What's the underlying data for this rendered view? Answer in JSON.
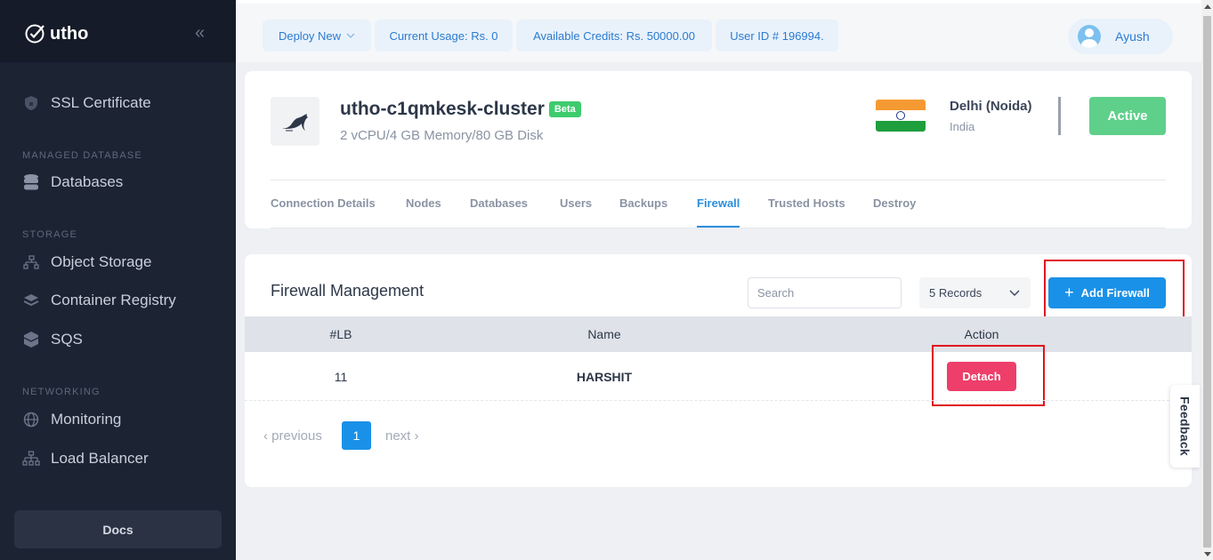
{
  "brand": {
    "name": "utho"
  },
  "sidebar": {
    "items": [
      {
        "label": "SSL Certificate",
        "icon": "shield-icon"
      },
      {
        "label": "Databases",
        "icon": "database-icon"
      },
      {
        "label": "Object Storage",
        "icon": "object-storage-icon"
      },
      {
        "label": "Container Registry",
        "icon": "layers-icon"
      },
      {
        "label": "SQS",
        "icon": "queue-icon"
      },
      {
        "label": "Monitoring",
        "icon": "globe-icon"
      },
      {
        "label": "Load Balancer",
        "icon": "network-icon"
      }
    ],
    "sections": {
      "managed_database": "MANAGED DATABASE",
      "storage": "STORAGE",
      "networking": "NETWORKING"
    },
    "docs_label": "Docs"
  },
  "topbar": {
    "deploy_new": "Deploy New",
    "current_usage": "Current Usage: Rs. 0",
    "available_credits": "Available Credits: Rs. 50000.00",
    "user_id": "User ID # 196994.",
    "user_name": "Ayush"
  },
  "cluster": {
    "name": "utho-c1qmkesk-cluster",
    "badge": "Beta",
    "specs": "2 vCPU/4 GB Memory/80 GB Disk",
    "location_city": "Delhi (Noida)",
    "location_country": "India",
    "status": "Active",
    "tabs": [
      "Connection Details",
      "Nodes",
      "Databases",
      "Users",
      "Backups",
      "Firewall",
      "Trusted Hosts",
      "Destroy"
    ],
    "active_tab": "Firewall"
  },
  "firewall": {
    "title": "Firewall Management",
    "search_placeholder": "Search",
    "records_label": "5 Records",
    "add_button": "Add Firewall",
    "columns": [
      "#LB",
      "Name",
      "Action"
    ],
    "rows": [
      {
        "id": "11",
        "name": "HARSHIT",
        "action": "Detach"
      }
    ],
    "pagination": {
      "prev": "‹ previous",
      "page": "1",
      "next": "next ›"
    }
  },
  "feedback_label": "Feedback",
  "colors": {
    "accent": "#1a91e8",
    "active_status": "#5fd08a",
    "detach": "#ee3e6a",
    "sidebar_bg": "#1c2333",
    "highlight": "#e0141e"
  }
}
